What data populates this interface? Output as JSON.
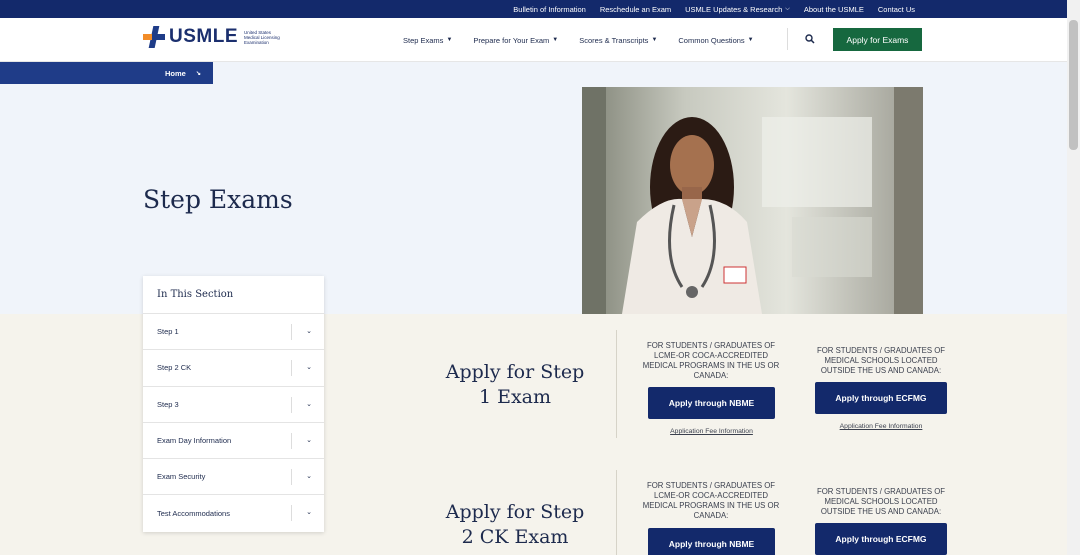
{
  "topbar": {
    "links": [
      "Bulletin of Information",
      "Reschedule an Exam",
      "USMLE Updates & Research",
      "About the USMLE",
      "Contact Us"
    ]
  },
  "header": {
    "logo_text": "USMLE",
    "logo_sub": "United States Medical Licensing Examination",
    "nav": [
      "Step Exams",
      "Prepare for Your Exam",
      "Scores & Transcripts",
      "Common Questions"
    ],
    "apply_label": "Apply for Exams"
  },
  "breadcrumb": {
    "label": "Home"
  },
  "hero": {
    "title": "Step Exams"
  },
  "sidebar": {
    "title": "In This Section",
    "items": [
      "Step 1",
      "Step 2 CK",
      "Step 3",
      "Exam Day Information",
      "Exam Security",
      "Test Accommodations"
    ]
  },
  "sections": [
    {
      "title_line1": "Apply for Step",
      "title_line2": "1 Exam",
      "col1_label": "FOR STUDENTS / GRADUATES OF LCME-OR COCA-ACCREDITED MEDICAL PROGRAMS IN THE US OR CANADA:",
      "col1_button": "Apply through NBME",
      "col1_fee": "Application Fee Information",
      "col2_label": "FOR STUDENTS / GRADUATES OF MEDICAL SCHOOLS LOCATED OUTSIDE THE US AND CANADA:",
      "col2_button": "Apply through ECFMG",
      "col2_fee": "Application Fee Information"
    },
    {
      "title_line1": "Apply for Step",
      "title_line2": "2 CK Exam",
      "col1_label": "FOR STUDENTS / GRADUATES OF LCME-OR COCA-ACCREDITED MEDICAL PROGRAMS IN THE US OR CANADA:",
      "col1_button": "Apply through NBME",
      "col2_label": "FOR STUDENTS / GRADUATES OF MEDICAL SCHOOLS LOCATED OUTSIDE THE US AND CANADA:",
      "col2_button": "Apply through ECFMG"
    }
  ],
  "colors": {
    "navy": "#13296b",
    "green": "#16683f",
    "cream": "#f5f3ec",
    "hero": "#f0f4fa"
  }
}
